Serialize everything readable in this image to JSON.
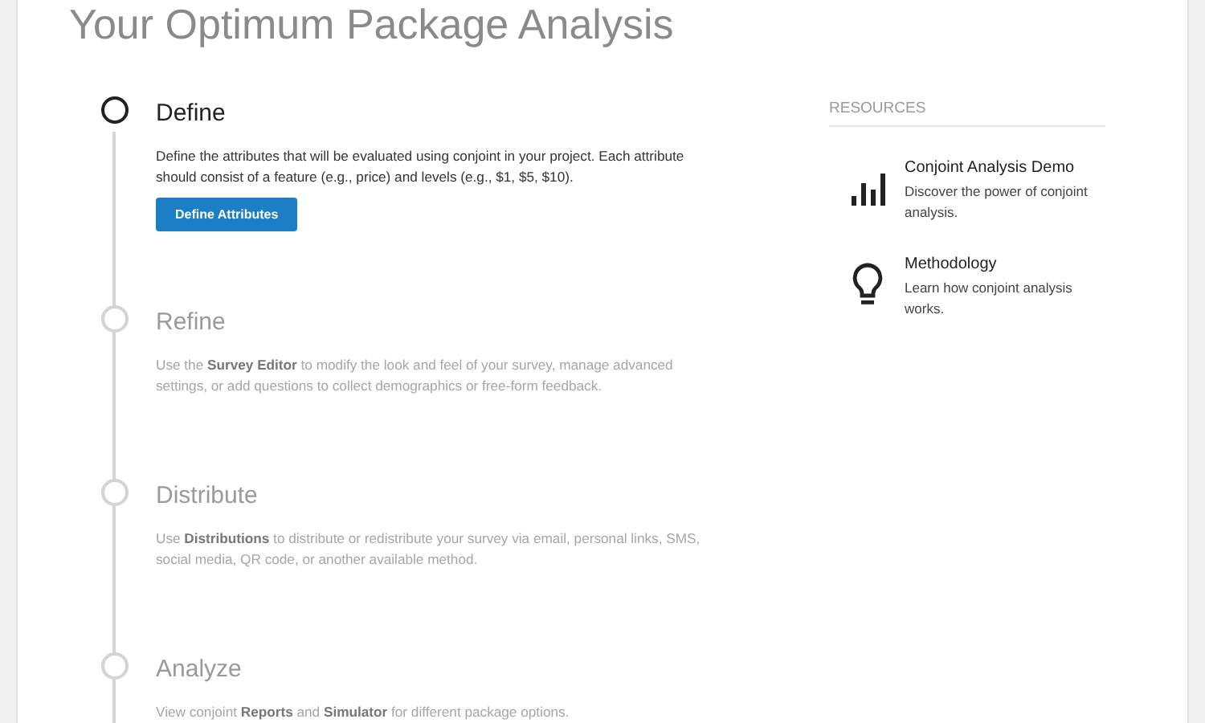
{
  "title": "Your Optimum Package Analysis",
  "steps": [
    {
      "title": "Define",
      "description": "Define the attributes that will be evaluated using conjoint in your project. Each attribute should consist of a feature (e.g., price) and levels (e.g., $1, $5, $10).",
      "active": true,
      "button": "Define Attributes"
    },
    {
      "title": "Refine",
      "description": "Use the **Survey Editor** to modify the look and feel of your survey, manage advanced settings, or add questions to collect demographics or free-form feedback.",
      "active": false
    },
    {
      "title": "Distribute",
      "description": "Use **Distributions** to distribute or redistribute your survey via email, personal links, SMS, social media, QR code, or another available method.",
      "active": false
    },
    {
      "title": "Analyze",
      "description": "View conjoint **Reports** and **Simulator** for different package options.",
      "active": false
    }
  ],
  "resources": {
    "heading": "RESOURCES",
    "items": [
      {
        "kind": "chart",
        "title": "Conjoint Analysis Demo",
        "description": "Discover the power of conjoint analysis."
      },
      {
        "kind": "bulb",
        "title": "Methodology",
        "description": "Learn how conjoint analysis works."
      }
    ]
  }
}
